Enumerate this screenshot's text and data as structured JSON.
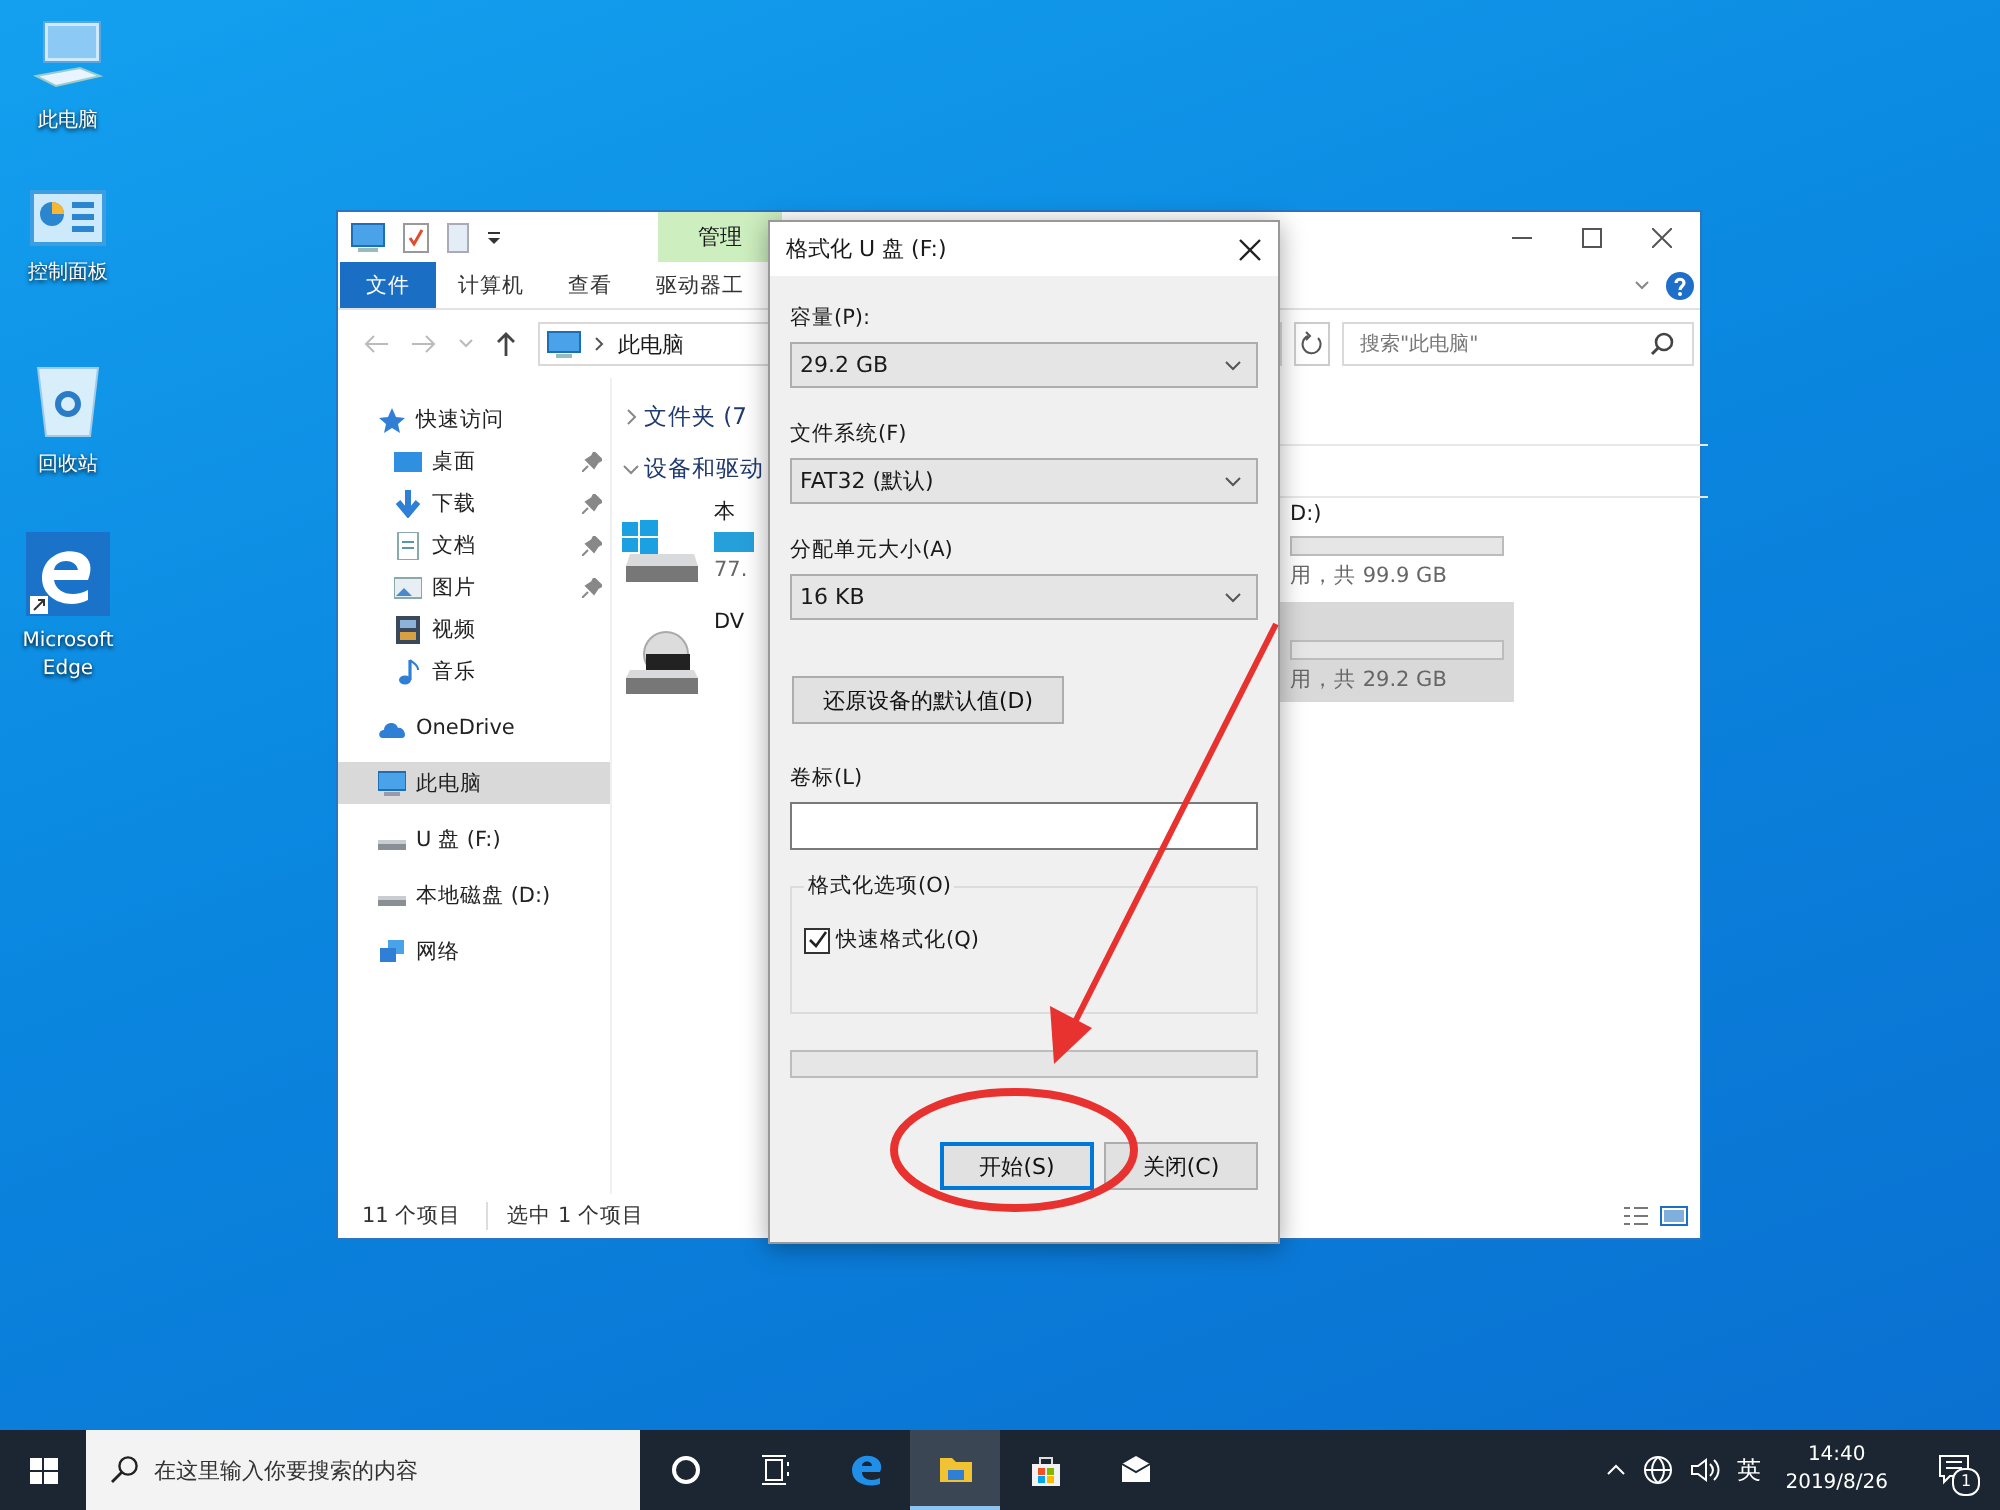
{
  "desktop_icons": [
    {
      "label": "此电脑",
      "kind": "pc"
    },
    {
      "label": "控制面板",
      "kind": "panel"
    },
    {
      "label": "回收站",
      "kind": "bin"
    },
    {
      "label": "Microsoft Edge",
      "kind": "edge"
    }
  ],
  "explorer": {
    "context_tab": "管理",
    "ribbon_tabs": [
      {
        "label": "文件",
        "selected": true
      },
      {
        "label": "计算机",
        "selected": false
      },
      {
        "label": "查看",
        "selected": false
      },
      {
        "label": "驱动器工",
        "selected": false
      }
    ],
    "address": "此电脑",
    "search": {
      "placeholder": "搜索\"此电脑\""
    },
    "nav": [
      {
        "label": "快速访问",
        "kind": "star",
        "selected": false,
        "children": [
          {
            "label": "桌面",
            "kind": "desktop",
            "pinned": true,
            "selected": false
          },
          {
            "label": "下载",
            "kind": "download",
            "pinned": true,
            "selected": false
          },
          {
            "label": "文档",
            "kind": "document",
            "pinned": true,
            "selected": false
          },
          {
            "label": "图片",
            "kind": "picture",
            "pinned": true,
            "selected": false
          },
          {
            "label": "视频",
            "kind": "video",
            "pinned": false,
            "selected": false
          },
          {
            "label": "音乐",
            "kind": "music",
            "pinned": false,
            "selected": false
          }
        ]
      },
      {
        "label": "OneDrive",
        "kind": "cloud",
        "selected": false
      },
      {
        "label": "此电脑",
        "kind": "pc",
        "selected": true
      },
      {
        "label": "U 盘 (F:)",
        "kind": "drive",
        "selected": false
      },
      {
        "label": "本地磁盘 (D:)",
        "kind": "drive",
        "selected": false
      },
      {
        "label": "网络",
        "kind": "network",
        "selected": false
      }
    ],
    "groups": [
      {
        "label": "文件夹 (7",
        "expanded": false
      },
      {
        "label": "设备和驱动",
        "expanded": true
      }
    ],
    "drives_left": [
      {
        "kind": "windows",
        "name": "本",
        "detail": "77."
      },
      {
        "kind": "dvd",
        "name": "DV"
      }
    ],
    "drives_right": [
      {
        "name": "D:)",
        "detail": "用，共 99.9 GB",
        "selected": false
      },
      {
        "detail": "用，共 29.2 GB",
        "selected": true
      }
    ],
    "status": {
      "count": "11 个项目",
      "selection": "选中 1 个项目"
    }
  },
  "dialog": {
    "title": "格式化 U 盘 (F:)",
    "fields": [
      {
        "label": "容量(P):",
        "value": "29.2 GB"
      },
      {
        "label": "文件系统(F)",
        "value": "FAT32 (默认)"
      },
      {
        "label": "分配单元大小(A)",
        "value": "16 KB"
      }
    ],
    "restore_button": "还原设备的默认值(D)",
    "volume_label": {
      "label": "卷标(L)"
    },
    "options": {
      "title": "格式化选项(O)",
      "items": [
        {
          "label": "快速格式化(Q)",
          "checked": true
        }
      ]
    },
    "progress": {
      "level": 0
    },
    "buttons": [
      {
        "label": "开始(S)",
        "default": true
      },
      {
        "label": "关闭(C)",
        "default": false
      }
    ]
  },
  "taskbar": {
    "search": {
      "placeholder": "在这里输入你要搜索的内容"
    },
    "apps": [
      {
        "kind": "cortana",
        "active": false
      },
      {
        "kind": "taskview",
        "active": false
      },
      {
        "kind": "edge",
        "active": false
      },
      {
        "kind": "explorer",
        "active": true
      },
      {
        "kind": "store",
        "active": false
      },
      {
        "kind": "mail",
        "active": false
      }
    ],
    "tray": {
      "ime": "英",
      "time": "14:40",
      "date": "2019/8/26",
      "notifications": "1"
    }
  }
}
